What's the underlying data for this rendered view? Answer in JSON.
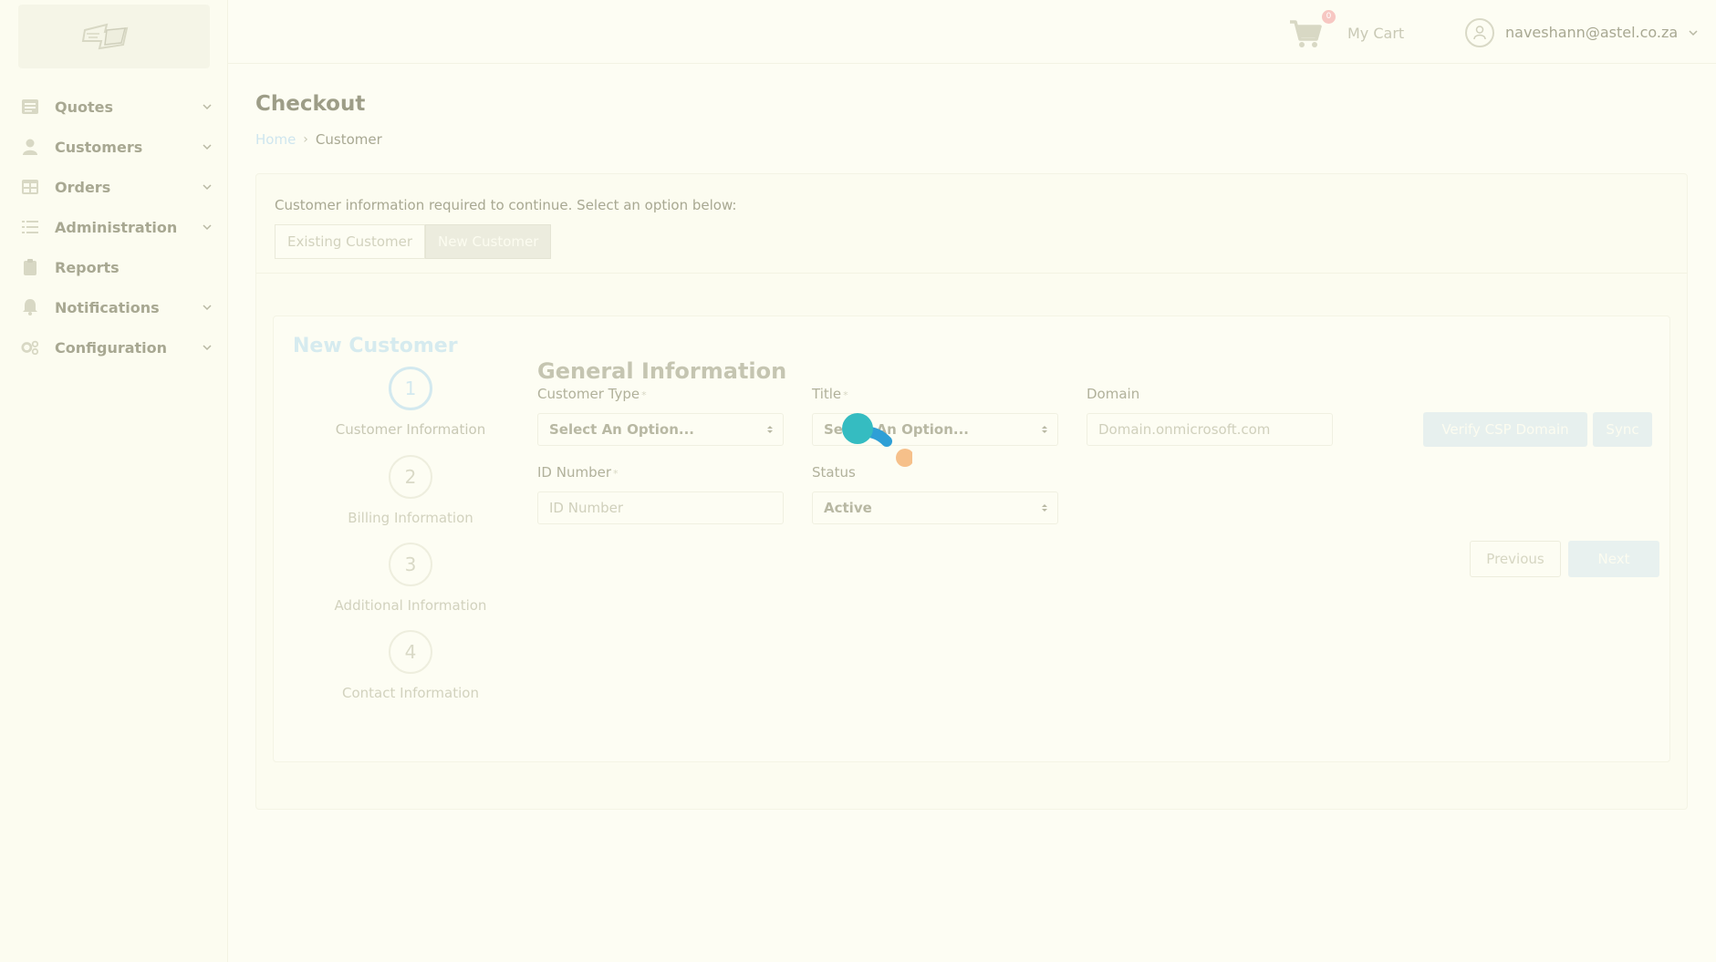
{
  "header": {
    "cart_badge": "0",
    "cart_label": "My Cart",
    "user_email": "naveshann@astel.co.za"
  },
  "sidebar": {
    "items": [
      {
        "label": "Quotes",
        "icon": "list-icon",
        "has_chevron": true
      },
      {
        "label": "Customers",
        "icon": "user-icon",
        "has_chevron": true
      },
      {
        "label": "Orders",
        "icon": "table-icon",
        "has_chevron": true
      },
      {
        "label": "Administration",
        "icon": "tasks-icon",
        "has_chevron": true
      },
      {
        "label": "Reports",
        "icon": "clipboard-icon",
        "has_chevron": false
      },
      {
        "label": "Notifications",
        "icon": "bell-icon",
        "has_chevron": true
      },
      {
        "label": "Configuration",
        "icon": "cogs-icon",
        "has_chevron": true
      }
    ]
  },
  "page": {
    "title": "Checkout",
    "breadcrumb": {
      "home": "Home",
      "current": "Customer"
    }
  },
  "customer_select": {
    "prompt": "Customer information required to continue. Select an option below:",
    "existing_label": "Existing Customer",
    "new_label": "New Customer",
    "selected": "New Customer"
  },
  "wizard": {
    "title": "New Customer",
    "steps": [
      {
        "number": "1",
        "label": "Customer Information",
        "active": true
      },
      {
        "number": "2",
        "label": "Billing Information",
        "active": false
      },
      {
        "number": "3",
        "label": "Additional Information",
        "active": false
      },
      {
        "number": "4",
        "label": "Contact Information",
        "active": false
      }
    ],
    "section_title": "General Information",
    "fields": {
      "customer_type": {
        "label": "Customer Type",
        "required": "*",
        "value": "Select An Option..."
      },
      "title": {
        "label": "Title",
        "required": "*",
        "value": "Select An Option..."
      },
      "domain": {
        "label": "Domain",
        "placeholder": "Domain.onmicrosoft.com"
      },
      "id_number": {
        "label": "ID Number",
        "required": "*",
        "placeholder": "ID Number"
      },
      "status": {
        "label": "Status",
        "value": "Active"
      }
    },
    "buttons": {
      "verify": "Verify CSP Domain",
      "sync": "Sync",
      "previous": "Previous",
      "next": "Next"
    }
  },
  "colors": {
    "background": "#fdfdf3",
    "accent_faded": "#d3e9ef",
    "spinner_teal": "#35bcc1",
    "spinner_blue": "#2e9fd6",
    "spinner_orange": "#f6c08a"
  }
}
